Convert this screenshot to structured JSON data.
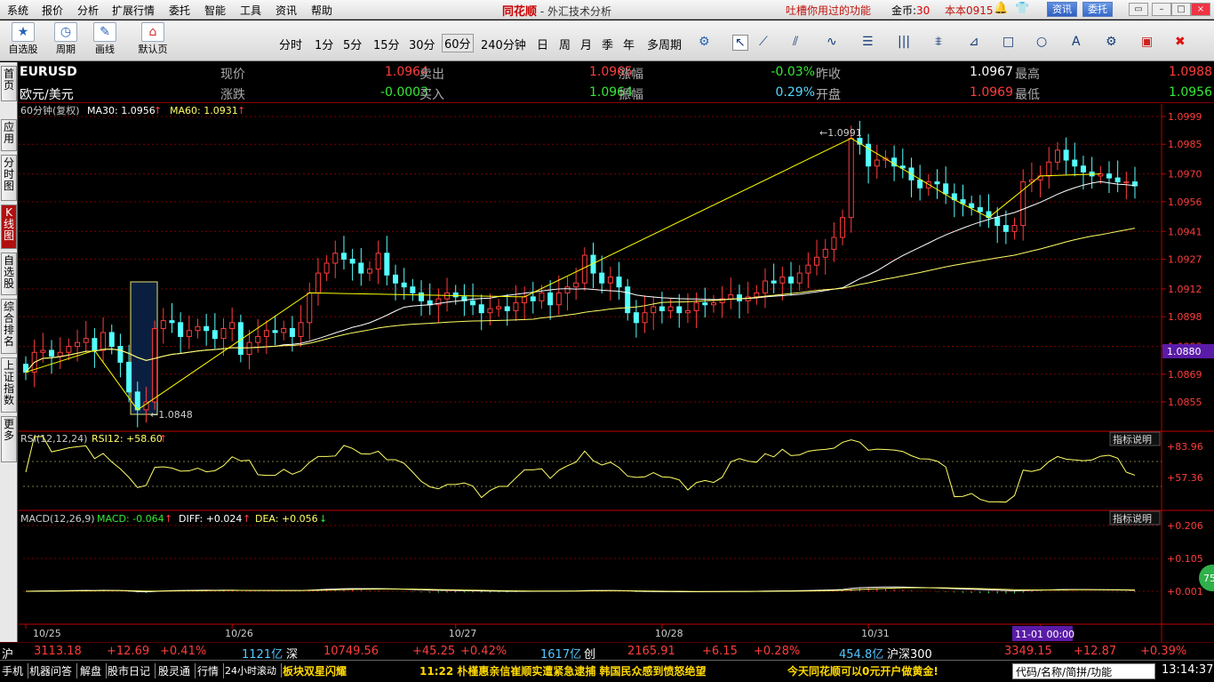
{
  "menu": {
    "items": [
      "系统",
      "报价",
      "分析",
      "扩展行情",
      "委托",
      "智能",
      "工具",
      "资讯",
      "帮助"
    ]
  },
  "title": {
    "brand": "同花顺",
    "sep": " - ",
    "subtitle": "外汇技术分析"
  },
  "top_right": {
    "feedback": "吐槽你用过的功能",
    "coins_label": "金币:",
    "coins_value": "30",
    "account": "本本0915",
    "news_btn": "资讯",
    "trade_btn": "委托"
  },
  "toolbar": {
    "tools": [
      {
        "label": "自选股",
        "icon": "star-icon"
      },
      {
        "label": "周期",
        "icon": "clock-icon"
      },
      {
        "label": "画线",
        "icon": "pencil-icon"
      },
      {
        "label": "默认页",
        "icon": "home-icon"
      }
    ],
    "periods": [
      "分时",
      "1分",
      "5分",
      "15分",
      "30分",
      "60分",
      "240分钟",
      "日",
      "周",
      "月",
      "季",
      "年",
      "多周期"
    ],
    "selected_period": "60分"
  },
  "left_tabs": [
    "首页",
    "应用",
    "分时图",
    "K线图",
    "自选股",
    "综合排名",
    "上证指数",
    "更多"
  ],
  "left_tabs_active": "K线图",
  "quote": {
    "symbol": "EURUSD",
    "name": "欧元/美元",
    "l_xianjia": "现价",
    "v_xianjia": "1.0964",
    "l_maichu": "卖出",
    "v_maichu": "1.0965",
    "l_zhangfu": "涨幅",
    "v_zhangfu": "-0.03%",
    "l_zuoshou": "昨收",
    "v_zuoshou": "1.0967",
    "l_zuigao": "最高",
    "v_zuigao": "1.0988",
    "l_zhangdie": "涨跌",
    "v_zhangdie": "-0.0003",
    "l_mairu": "买入",
    "v_mairu": "1.0964",
    "l_zhenfu": "振幅",
    "v_zhenfu": "0.29%",
    "l_kaipan": "开盘",
    "v_kaipan": "1.0969",
    "l_zuidi": "最低",
    "v_zuidi": "1.0956"
  },
  "kline_header": {
    "period": "60分钟(复权)",
    "ma30": "MA30: 1.0956",
    "ma60": "MA60: 1.0931"
  },
  "rsi_header": {
    "label": "RSI(12,12,24)",
    "value": "RSI12: +58.60",
    "btn": "指标说明"
  },
  "macd_header": {
    "label": "MACD(12,26,9)",
    "macd": "MACD: -0.064",
    "diff": "DIFF: +0.024",
    "dea": "DEA: +0.056",
    "btn": "指标说明"
  },
  "colors": {
    "up": "#ff3c3c",
    "down": "#54ffff",
    "ma_white": "#ffffff",
    "ma_yellow": "#ffff66",
    "zigzag": "#ffff00",
    "grid": "#7a0000",
    "axis": "#c00000"
  },
  "chart_data": {
    "type": "candlestick",
    "price_axis": [
      "1.0999",
      "1.0985",
      "1.0970",
      "1.0956",
      "1.0941",
      "1.0927",
      "1.0912",
      "1.0898",
      "1.0883",
      "1.0869",
      "1.0855"
    ],
    "current_price_tag": "1.0880",
    "high_label": "1.0991",
    "low_label": "1.0848",
    "date_labels": [
      "10/25",
      "10/26",
      "10/27",
      "10/28",
      "10/31",
      "11/01"
    ],
    "cursor_date": "11-01 00:00",
    "rsi_axis": [
      "+83.96",
      "+57.36"
    ],
    "macd_axis": [
      "+0.206",
      "+0.105",
      "+0.001"
    ],
    "closes": [
      1.087,
      1.088,
      1.0881,
      1.0878,
      1.088,
      1.0883,
      1.0885,
      1.0887,
      1.0881,
      1.089,
      1.0883,
      1.0875,
      1.086,
      1.0851,
      1.0855,
      1.0892,
      1.0896,
      1.0895,
      1.0888,
      1.0891,
      1.0893,
      1.0891,
      1.0887,
      1.0892,
      1.0895,
      1.0879,
      1.0885,
      1.0888,
      1.0891,
      1.089,
      1.0892,
      1.0888,
      1.0895,
      1.091,
      1.092,
      1.0925,
      1.093,
      1.0927,
      1.0925,
      1.092,
      1.0922,
      1.093,
      1.0919,
      1.0915,
      1.0913,
      1.091,
      1.0906,
      1.0904,
      1.0907,
      1.091,
      1.0908,
      1.0906,
      1.0904,
      1.09,
      1.0902,
      1.0903,
      1.0901,
      1.0905,
      1.0908,
      1.0906,
      1.091,
      1.0904,
      1.091,
      1.0913,
      1.0915,
      1.0929,
      1.092,
      1.0915,
      1.0918,
      1.0913,
      1.09,
      1.0895,
      1.09,
      1.0903,
      1.0901,
      1.0903,
      1.09,
      1.0901,
      1.0905,
      1.0904,
      1.0905,
      1.0907,
      1.0909,
      1.0906,
      1.0908,
      1.091,
      1.0916,
      1.0915,
      1.0918,
      1.0915,
      1.092,
      1.0924,
      1.0928,
      1.0932,
      1.0938,
      1.0948,
      1.0988,
      1.0985,
      1.0974,
      1.0977,
      1.0978,
      1.0974,
      1.0973,
      1.0967,
      1.0963,
      1.0966,
      1.0965,
      1.096,
      1.0957,
      1.0955,
      1.0953,
      1.0951,
      1.0948,
      1.0944,
      1.0941,
      1.0944,
      1.0966,
      1.0967,
      1.0969,
      1.0976,
      1.0982,
      1.0977,
      1.0974,
      1.0971,
      1.0969,
      1.097,
      1.0968,
      1.0966,
      1.0966,
      1.0964
    ]
  },
  "ticker": [
    {
      "t": "沪",
      "c": "#fff"
    },
    {
      "t": "3113.18",
      "c": "#ff3c3c"
    },
    {
      "t": "+12.69",
      "c": "#ff3c3c"
    },
    {
      "t": "+0.41%",
      "c": "#ff3c3c"
    },
    {
      "t": "1121亿",
      "c": "#54c8ff"
    },
    {
      "t": "深",
      "c": "#fff"
    },
    {
      "t": "10749.56",
      "c": "#ff3c3c"
    },
    {
      "t": "+45.25",
      "c": "#ff3c3c"
    },
    {
      "t": "+0.42%",
      "c": "#ff3c3c"
    },
    {
      "t": "1617亿",
      "c": "#54c8ff"
    },
    {
      "t": "创",
      "c": "#fff"
    },
    {
      "t": "2165.91",
      "c": "#ff3c3c"
    },
    {
      "t": "+6.15",
      "c": "#ff3c3c"
    },
    {
      "t": "+0.28%",
      "c": "#ff3c3c"
    },
    {
      "t": "454.8亿",
      "c": "#54c8ff"
    },
    {
      "t": "沪深300",
      "c": "#fff"
    },
    {
      "t": "3349.15",
      "c": "#ff3c3c"
    },
    {
      "t": "+12.87",
      "c": "#ff3c3c"
    },
    {
      "t": "+0.39%",
      "c": "#ff3c3c"
    }
  ],
  "statusbar": {
    "tabs": [
      "手机",
      "机器问答",
      "解盘",
      "股市日记",
      "股灵通",
      "行情",
      "24小时滚动"
    ],
    "news1": "板块双星闪耀",
    "news2": "11:22 朴槿惠亲信崔顺实遭紧急逮捕  韩国民众感到愤怒绝望",
    "news3": "今天同花顺可以0元开户做黄金!",
    "search_placeholder": "代码/名称/简拼/功能",
    "time": "13:14:37"
  },
  "float_badge": "75"
}
